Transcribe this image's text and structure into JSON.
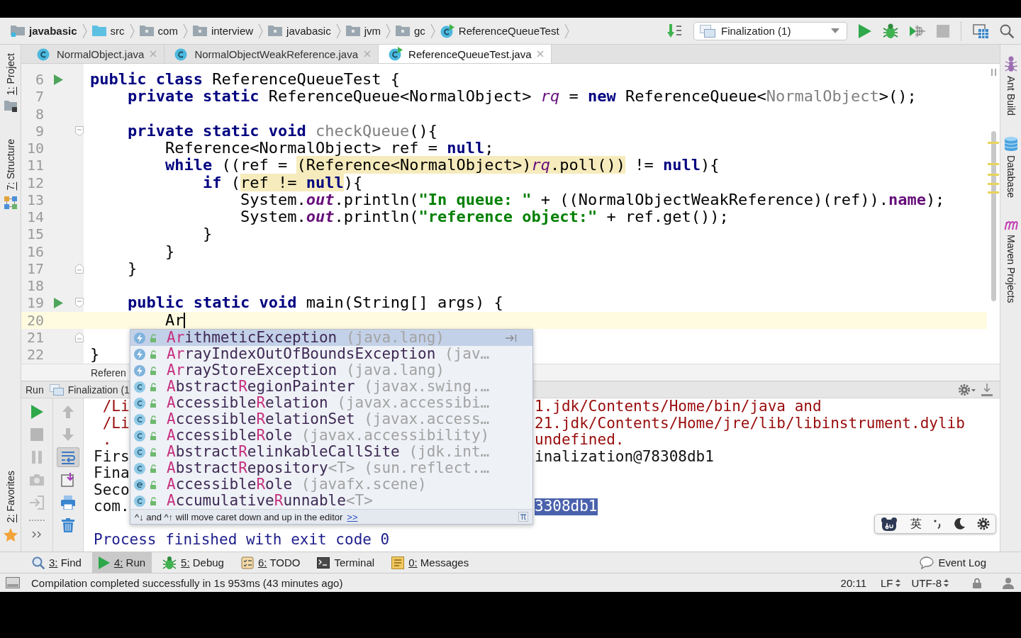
{
  "nav_bar": {
    "breadcrumbs": [
      {
        "label": "javabasic",
        "kind": "module"
      },
      {
        "label": "src",
        "kind": "source_folder"
      },
      {
        "label": "com",
        "kind": "package"
      },
      {
        "label": "interview",
        "kind": "package"
      },
      {
        "label": "javabasic",
        "kind": "package"
      },
      {
        "label": "jvm",
        "kind": "package"
      },
      {
        "label": "gc",
        "kind": "package"
      },
      {
        "label": "ReferenceQueueTest",
        "kind": "runnable_class"
      }
    ],
    "run_config": "Finalization (1)",
    "actions": [
      {
        "kind": "run",
        "disabled": false
      },
      {
        "kind": "debug",
        "disabled": false
      },
      {
        "kind": "coverage",
        "disabled": false
      },
      {
        "kind": "stop",
        "disabled": true
      },
      {
        "kind": "project_structure",
        "disabled": false
      },
      {
        "kind": "search",
        "disabled": false
      }
    ]
  },
  "tabs": [
    {
      "label": "NormalObject.java",
      "selected": false,
      "runnable": false
    },
    {
      "label": "NormalObjectWeakReference.java",
      "selected": false,
      "runnable": false
    },
    {
      "label": "ReferenceQueueTest.java",
      "selected": true,
      "runnable": true
    }
  ],
  "left_strip": {
    "top": [
      {
        "label": "1: Project",
        "kind": "project",
        "mnemonic": true
      },
      {
        "label": "7: Structure",
        "kind": "structure",
        "mnemonic": true
      }
    ],
    "bottom": [
      {
        "label": "2: Favorites",
        "kind": "favorites",
        "mnemonic": true
      }
    ]
  },
  "right_strip": [
    {
      "label": "Ant Build",
      "kind": "ant"
    },
    {
      "label": "Database",
      "kind": "database"
    },
    {
      "label": "Maven Projects",
      "kind": "maven"
    }
  ],
  "editor": {
    "lines": [
      {
        "number": "6",
        "run_marker": true,
        "current": false,
        "fold_start": false,
        "fold_end": false,
        "tokens": [
          {
            "text": "public class",
            "kind": "keyword",
            "warning": false
          },
          {
            "text": " ReferenceQueueTest {",
            "kind": "plain",
            "warning": false
          }
        ]
      },
      {
        "number": "7",
        "run_marker": false,
        "current": false,
        "fold_start": false,
        "fold_end": false,
        "tokens": [
          {
            "text": "    private static",
            "kind": "keyword",
            "warning": false
          },
          {
            "text": " ReferenceQueue<NormalObject> ",
            "kind": "plain",
            "warning": false
          },
          {
            "text": "rq",
            "kind": "static_field",
            "warning": false
          },
          {
            "text": " = ",
            "kind": "plain",
            "warning": false
          },
          {
            "text": "new",
            "kind": "keyword",
            "warning": false
          },
          {
            "text": " ReferenceQueue<",
            "kind": "plain",
            "warning": false
          },
          {
            "text": "NormalObject",
            "kind": "unused",
            "warning": false
          },
          {
            "text": ">();",
            "kind": "plain",
            "warning": false
          }
        ]
      },
      {
        "number": "8",
        "run_marker": false,
        "current": false,
        "fold_start": false,
        "fold_end": false
      },
      {
        "number": "9",
        "run_marker": false,
        "current": false,
        "fold_start": true,
        "fold_end": false,
        "tokens": [
          {
            "text": "    private static void",
            "kind": "keyword",
            "warning": false
          },
          {
            "text": " checkQueue",
            "kind": "unused",
            "warning": false
          },
          {
            "text": "(){",
            "kind": "plain",
            "warning": false
          }
        ]
      },
      {
        "number": "10",
        "run_marker": false,
        "current": false,
        "fold_start": false,
        "fold_end": false,
        "tokens": [
          {
            "text": "        Reference<NormalObject> ref = ",
            "kind": "plain",
            "warning": false
          },
          {
            "text": "null",
            "kind": "keyword",
            "warning": false
          },
          {
            "text": ";",
            "kind": "plain",
            "warning": false
          }
        ]
      },
      {
        "number": "11",
        "run_marker": false,
        "current": false,
        "fold_start": false,
        "fold_end": false,
        "tokens": [
          {
            "text": "        while",
            "kind": "keyword",
            "warning": false
          },
          {
            "text": " ((ref = ",
            "kind": "plain",
            "warning": false
          },
          {
            "text": "(Reference<NormalObject>)",
            "kind": "plain",
            "warning": true
          },
          {
            "text": "rq",
            "kind": "static_field",
            "warning": true
          },
          {
            "text": ".poll())",
            "kind": "plain",
            "warning": true
          },
          {
            "text": " != ",
            "kind": "plain",
            "warning": false
          },
          {
            "text": "null",
            "kind": "keyword",
            "warning": false
          },
          {
            "text": "){",
            "kind": "plain",
            "warning": false
          }
        ]
      },
      {
        "number": "12",
        "run_marker": false,
        "current": false,
        "fold_start": false,
        "fold_end": false,
        "tokens": [
          {
            "text": "            if",
            "kind": "keyword",
            "warning": false
          },
          {
            "text": " (",
            "kind": "plain",
            "warning": false
          },
          {
            "text": "ref != ",
            "kind": "plain",
            "warning": true
          },
          {
            "text": "null",
            "kind": "keyword",
            "warning": true
          },
          {
            "text": "){",
            "kind": "plain",
            "warning": false
          }
        ]
      },
      {
        "number": "13",
        "run_marker": false,
        "current": false,
        "fold_start": false,
        "fold_end": false,
        "tokens": [
          {
            "text": "                System.",
            "kind": "plain",
            "warning": false
          },
          {
            "text": "out",
            "kind": "constant",
            "warning": false
          },
          {
            "text": ".println(",
            "kind": "plain",
            "warning": false
          },
          {
            "text": "\"In queue: \"",
            "kind": "string",
            "warning": false
          },
          {
            "text": " + ((NormalObjectWeakReference)(ref)).",
            "kind": "plain",
            "warning": false
          },
          {
            "text": "name",
            "kind": "field",
            "warning": false
          },
          {
            "text": ");",
            "kind": "plain",
            "warning": false
          }
        ]
      },
      {
        "number": "14",
        "run_marker": false,
        "current": false,
        "fold_start": false,
        "fold_end": false,
        "tokens": [
          {
            "text": "                System.",
            "kind": "plain",
            "warning": false
          },
          {
            "text": "out",
            "kind": "constant",
            "warning": false
          },
          {
            "text": ".println(",
            "kind": "plain",
            "warning": false
          },
          {
            "text": "\"reference object:\"",
            "kind": "string",
            "warning": false
          },
          {
            "text": " + ref.get());",
            "kind": "plain",
            "warning": false
          }
        ]
      },
      {
        "number": "15",
        "run_marker": false,
        "current": false,
        "fold_start": false,
        "fold_end": false,
        "tokens": [
          {
            "text": "            }",
            "kind": "plain",
            "warning": false
          }
        ]
      },
      {
        "number": "16",
        "run_marker": false,
        "current": false,
        "fold_start": false,
        "fold_end": false,
        "tokens": [
          {
            "text": "        }",
            "kind": "plain",
            "warning": false
          }
        ]
      },
      {
        "number": "17",
        "run_marker": false,
        "current": false,
        "fold_start": false,
        "fold_end": true,
        "tokens": [
          {
            "text": "    }",
            "kind": "plain",
            "warning": false
          }
        ]
      },
      {
        "number": "18",
        "run_marker": false,
        "current": false,
        "fold_start": false,
        "fold_end": false
      },
      {
        "number": "19",
        "run_marker": true,
        "current": false,
        "fold_start": true,
        "fold_end": false,
        "tokens": [
          {
            "text": "    public static void",
            "kind": "keyword",
            "warning": false
          },
          {
            "text": " main(String[] args) {",
            "kind": "plain",
            "warning": false
          }
        ]
      },
      {
        "number": "20",
        "run_marker": false,
        "current": true,
        "fold_start": false,
        "fold_end": false,
        "tokens": [
          {
            "text": "        Ar",
            "kind": "plain",
            "warning": false
          }
        ]
      },
      {
        "number": "21",
        "run_marker": false,
        "current": false,
        "fold_start": false,
        "fold_end": true
      },
      {
        "number": "22",
        "run_marker": false,
        "current": false,
        "fold_start": false,
        "fold_end": false,
        "tokens": [
          {
            "text": "}",
            "kind": "plain",
            "warning": false
          }
        ]
      }
    ],
    "breadcrumb": "Referen"
  },
  "completion_popup": {
    "items": [
      {
        "name": "**Ar**ithmeticException",
        "detail": "(java.lang)",
        "kind": "exception",
        "selected": true
      },
      {
        "name": "**Ar**rayIndexOutOfBoundsException",
        "detail": "(jav…",
        "kind": "exception",
        "selected": false
      },
      {
        "name": "**Ar**rayStoreException",
        "detail": "(java.lang)",
        "kind": "exception",
        "selected": false
      },
      {
        "name": "**A**bstract**R**egionPainter",
        "detail": "(javax.swing.…",
        "kind": "class",
        "selected": false
      },
      {
        "name": "**A**ccessible**R**elation",
        "detail": "(javax.accessibi…",
        "kind": "class",
        "selected": false
      },
      {
        "name": "**A**ccessible**R**elationSet",
        "detail": "(javax.access…",
        "kind": "class",
        "selected": false
      },
      {
        "name": "**A**ccessible**R**ole",
        "detail": "(javax.accessibility)",
        "kind": "class",
        "selected": false
      },
      {
        "name": "**A**bstract**R**elinkableCallSite",
        "detail": "(jdk.int…",
        "kind": "class",
        "selected": false
      },
      {
        "name": "**A**bstract**R**epository",
        "type_params": "<T>",
        "detail": "(sun.reflect.…",
        "kind": "class",
        "selected": false
      },
      {
        "name": "**A**ccessible**R**ole",
        "detail": "(javafx.scene)",
        "kind": "enum",
        "selected": false
      },
      {
        "name": "**A**ccumulative**R**unnable",
        "type_params": "<T>",
        "kind": "class",
        "selected": false
      }
    ],
    "hint": "^↓ and ^↑ will move caret down and up in the editor",
    "hint_link": ">>"
  },
  "run_panel": {
    "title": "Run",
    "tab": "Finalization (1",
    "toolbar_left": [
      {
        "kind": "rerun",
        "disabled": false
      },
      {
        "kind": "stop",
        "disabled": true
      },
      {
        "kind": "pause",
        "disabled": true
      },
      {
        "kind": "dump_threads",
        "disabled": true
      },
      {
        "kind": "exit",
        "disabled": true
      }
    ],
    "toolbar_right": [
      {
        "kind": "up",
        "disabled": true,
        "selected": false
      },
      {
        "kind": "down",
        "disabled": true,
        "selected": false
      },
      {
        "kind": "soft_wrap",
        "disabled": false,
        "selected": true
      },
      {
        "kind": "scroll_to_end",
        "disabled": false,
        "selected": false
      },
      {
        "kind": "print",
        "disabled": false,
        "selected": false
      },
      {
        "kind": "clear",
        "disabled": false,
        "selected": false
      }
    ],
    "console": [
      {
        "kind": "error",
        "wrapped": true,
        "left": "/Li",
        "right": {
          "text": "1.jdk/Contents/Home/bin/java and",
          "selected": false
        }
      },
      {
        "kind": "error",
        "wrapped": true,
        "left": "/Li",
        "right": {
          "text": "21.jdk/Contents/Home/jre/lib/libinstrument.dylib",
          "selected": false
        }
      },
      {
        "kind": "error",
        "wrapped": true,
        "left": ".",
        "right": {
          "text": "undefined.",
          "selected": false
        }
      },
      {
        "kind": "output",
        "wrapped": false,
        "left": "Firs",
        "right": {
          "text": "inalization@78308db1",
          "selected": false
        }
      },
      {
        "kind": "output",
        "wrapped": false,
        "left": "Fina"
      },
      {
        "kind": "output",
        "wrapped": false,
        "left": "Seco"
      },
      {
        "kind": "output",
        "wrapped": false,
        "left": "com.",
        "right": {
          "text": "3308db1",
          "selected": true
        }
      },
      {
        "kind": "blank"
      },
      {
        "kind": "system",
        "wrapped": false,
        "left": "Process finished with exit code 0"
      }
    ]
  },
  "ime_toolbar": {
    "mode": "英"
  },
  "tool_window_bar": {
    "items": [
      {
        "label": "3: Find",
        "kind": "find",
        "mnemonic": true,
        "selected": false
      },
      {
        "label": "4: Run",
        "kind": "run",
        "mnemonic": true,
        "selected": true
      },
      {
        "label": "5: Debug",
        "kind": "debug",
        "mnemonic": true,
        "selected": false
      },
      {
        "label": "6: TODO",
        "kind": "todo",
        "mnemonic": true,
        "selected": false
      },
      {
        "label": "Terminal",
        "kind": "terminal",
        "mnemonic": false,
        "selected": false
      },
      {
        "label": "0: Messages",
        "kind": "messages",
        "mnemonic": true,
        "selected": false
      }
    ],
    "event_log": "Event Log"
  },
  "status_bar": {
    "message": "Compilation completed successfully in 1s 953ms (43 minutes ago)",
    "position": "20:11",
    "line_separator": "LF",
    "encoding": "UTF-8"
  }
}
